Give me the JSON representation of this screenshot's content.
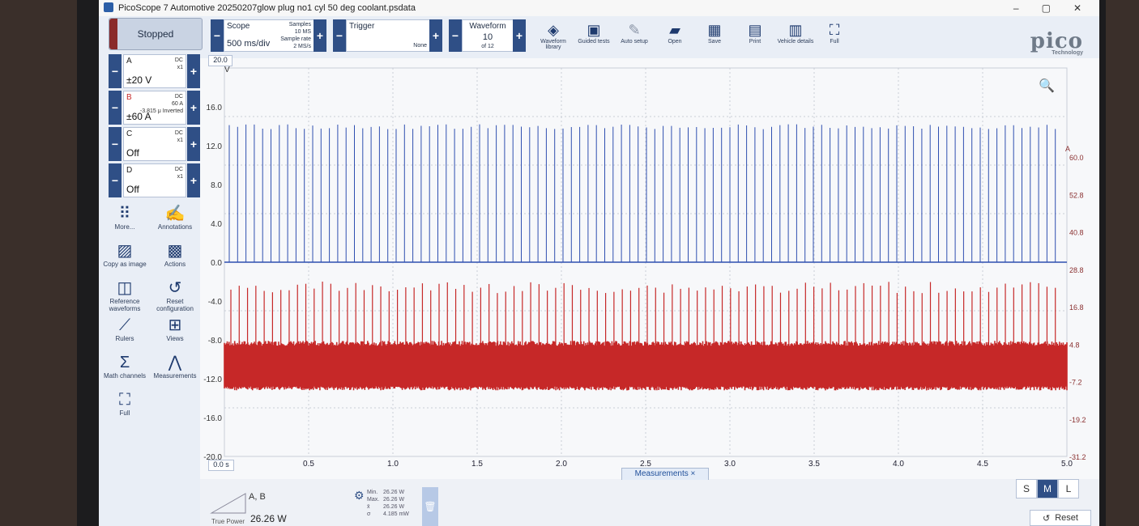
{
  "window": {
    "title": "PicoScope 7 Automotive 20250207glow plug no1 cyl 50 deg coolant.psdata",
    "controls": [
      "–",
      "▢",
      "✕"
    ]
  },
  "toolbar": {
    "status_label": "Stopped",
    "scope": {
      "title": "Scope",
      "timebase": "500 ms/div",
      "samples_label": "Samples",
      "samples_value": "10 MS",
      "rate_label": "Sample rate",
      "rate_value": "2 MS/s"
    },
    "trigger": {
      "title": "Trigger",
      "mode": "None"
    },
    "waveform": {
      "title": "Waveform",
      "index": "10",
      "of": "of 12"
    },
    "tools": [
      {
        "label": "Waveform library",
        "icon": "stack-icon"
      },
      {
        "label": "Guided tests",
        "icon": "car-icon"
      },
      {
        "label": "Auto setup",
        "icon": "wand-icon"
      },
      {
        "label": "Open",
        "icon": "folder-icon"
      },
      {
        "label": "Save",
        "icon": "save-icon"
      },
      {
        "label": "Print",
        "icon": "printer-icon"
      },
      {
        "label": "Vehicle details",
        "icon": "clipboard-icon"
      },
      {
        "label": "Full",
        "icon": "fullscreen-icon"
      }
    ],
    "logo": "pico",
    "logo_sub": "Technology"
  },
  "channels": [
    {
      "name": "A",
      "range": "±20 V",
      "coupling": "DC",
      "probe": "x1",
      "extra": "",
      "color": "#2f4fb0"
    },
    {
      "name": "B",
      "range": "±60 A",
      "coupling": "DC",
      "probe": "60 A",
      "extra": "-3.815 μ Inverted",
      "color": "#c62828"
    },
    {
      "name": "C",
      "range": "Off",
      "coupling": "DC",
      "probe": "x1",
      "extra": "",
      "color": "#333333"
    },
    {
      "name": "D",
      "range": "Off",
      "coupling": "DC",
      "probe": "x1",
      "extra": "",
      "color": "#333333"
    }
  ],
  "sidebar_buttons": [
    {
      "label": "More...",
      "icon": "dots-grid-icon"
    },
    {
      "label": "Annotations",
      "icon": "annotation-pen-icon"
    },
    {
      "label": "Copy as image",
      "icon": "image-copy-icon"
    },
    {
      "label": "Actions",
      "icon": "clapper-icon"
    },
    {
      "label": "Reference waveforms",
      "icon": "reference-wave-icon"
    },
    {
      "label": "Reset configuration",
      "icon": "history-icon"
    },
    {
      "label": "Rulers",
      "icon": "ruler-icon"
    },
    {
      "label": "Views",
      "icon": "grid-view-icon"
    },
    {
      "label": "Math channels",
      "icon": "sigma-icon"
    },
    {
      "label": "Measurements",
      "icon": "compass-icon"
    },
    {
      "label": "Full",
      "icon": "fullscreen-icon"
    }
  ],
  "plot": {
    "y_top_box": "20.0",
    "y_unit": "V",
    "right_unit": "A",
    "x_start_box": "0.0 s",
    "zoom_icon": "magnifier-icon"
  },
  "chart_data": {
    "type": "line",
    "x_label_unit": "s",
    "xlim": [
      0,
      5.0
    ],
    "x_ticks": [
      "0.5",
      "1.0",
      "1.5",
      "2.0",
      "2.5",
      "3.0",
      "3.5",
      "4.0",
      "4.5",
      "5.0"
    ],
    "left_axis": {
      "unit": "V",
      "ylim": [
        -20,
        20
      ],
      "ticks": [
        "16.0",
        "12.0",
        "8.0",
        "4.0",
        "0.0",
        "-4.0",
        "-8.0",
        "-12.0",
        "-16.0",
        "-20.0"
      ]
    },
    "right_axis": {
      "unit": "A",
      "ticks": [
        "60.0",
        "52.8",
        "40.8",
        "28.8",
        "16.8",
        "4.8",
        "-7.2",
        "-19.2",
        "-31.2"
      ]
    },
    "series": [
      {
        "name": "A",
        "color": "#2f4fb0",
        "pulse_count": 100,
        "baseline": 0.0,
        "peak": 14.2
      },
      {
        "name": "B",
        "color": "#c62828",
        "pulse_count": 100,
        "band_low": -12.8,
        "band_high": -8.6,
        "peak": -2.0
      }
    ],
    "grid": true
  },
  "measurements": {
    "tab_label": "Measurements",
    "channels": "A, B",
    "type_label": "True Power",
    "value": "26.26 W",
    "stats": [
      {
        "label": "Min.",
        "value": "26.26 W"
      },
      {
        "label": "Max.",
        "value": "26.26 W"
      },
      {
        "label": "x̄",
        "value": "26.26 W"
      },
      {
        "label": "σ",
        "value": "4.185 mW"
      }
    ]
  },
  "view_size": {
    "options": [
      "S",
      "M",
      "L"
    ],
    "selected": "M"
  },
  "reset_label": "Reset"
}
